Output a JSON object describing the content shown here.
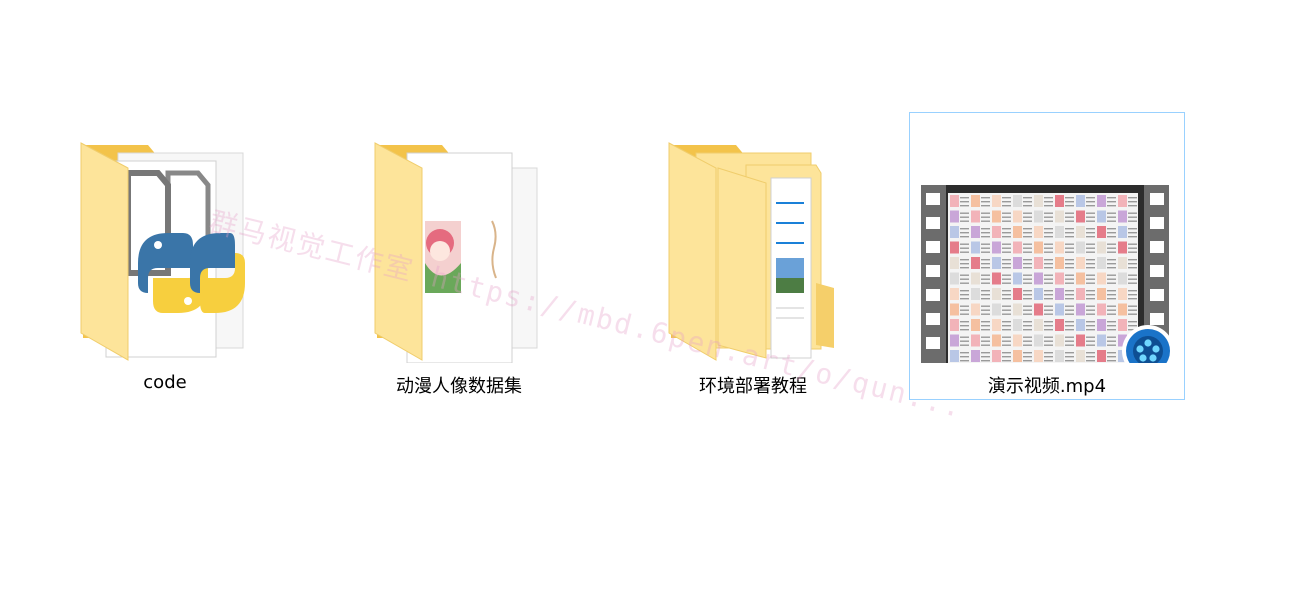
{
  "items": [
    {
      "name": "code",
      "type": "folder",
      "icon": "python-folder-icon",
      "selected": false
    },
    {
      "name": "动漫人像数据集",
      "type": "folder",
      "icon": "image-folder-icon",
      "selected": false
    },
    {
      "name": "环境部署教程",
      "type": "folder",
      "icon": "document-folder-icon",
      "selected": false
    },
    {
      "name": "演示视频.mp4",
      "type": "video",
      "icon": "video-thumbnail-icon",
      "selected": true
    }
  ],
  "watermark": "群马视觉工作室 https://mbd.6pen.art/o/qun...",
  "colors": {
    "folder_back": "#f5c84c",
    "folder_front": "#fde49a",
    "selection_border": "#99d1ff",
    "python_blue": "#3a75a8",
    "python_yellow": "#f7cf3e",
    "player_blue": "#1a73c8"
  }
}
